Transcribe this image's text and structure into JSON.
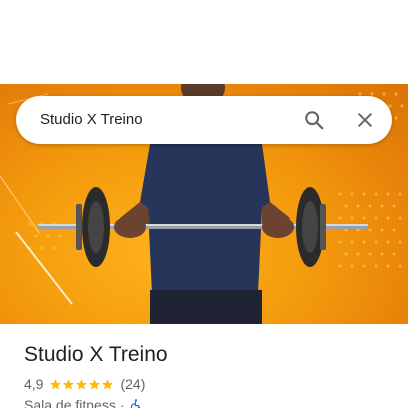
{
  "search": {
    "query": "Studio X Treino"
  },
  "place": {
    "name": "Studio X Treino",
    "rating": "4,9",
    "stars": 5,
    "review_count": "(24)",
    "category": "Sala de fitness",
    "separator": "·"
  },
  "icons": {
    "search": "search-icon",
    "close": "close-icon",
    "star": "star-icon",
    "accessibility": "wheelchair-icon"
  },
  "colors": {
    "star": "#fbbc04",
    "hero_orange": "#f39a0c",
    "accessibility_blue": "#1a73e8",
    "text_primary": "#202124",
    "text_secondary": "#5f6368"
  }
}
